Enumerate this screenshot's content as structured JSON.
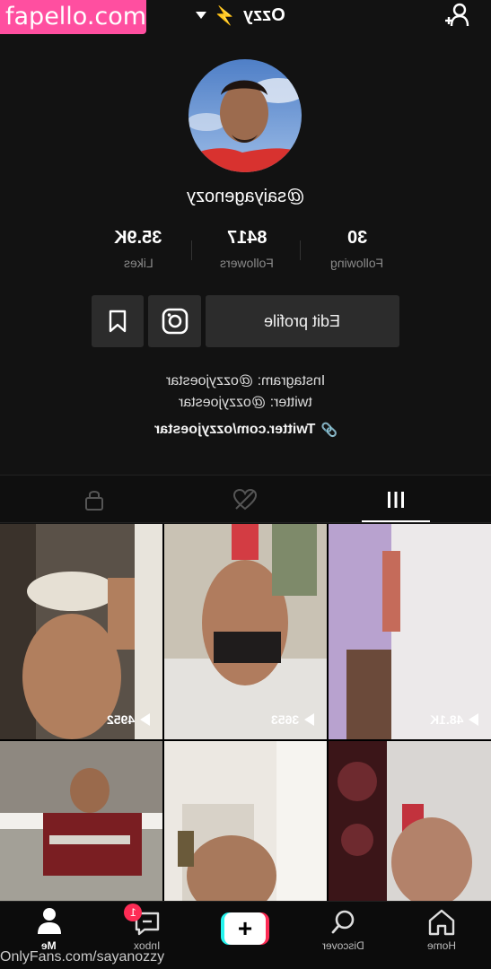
{
  "watermark": {
    "site": "fapello.com",
    "footer": "OnlyFans.com/sayanozzy"
  },
  "header": {
    "account_name": "Ozzy",
    "account_emoji": "⚡"
  },
  "profile": {
    "username": "@saiyagenozy",
    "stats": [
      {
        "value": "30",
        "label": "Following"
      },
      {
        "value": "8417",
        "label": "Followers"
      },
      {
        "value": "35.9K",
        "label": "Likes"
      }
    ],
    "edit_profile_label": "Edit profile",
    "bio_lines": [
      "Instagram: @ozzyjoestar",
      "twitter: @ozzyjoestar"
    ],
    "link": "Twitter.com/ozzyjoestar"
  },
  "videos": [
    {
      "views": "48.1K"
    },
    {
      "views": "3653"
    },
    {
      "views": "4952"
    },
    {
      "views": ""
    },
    {
      "views": ""
    },
    {
      "views": ""
    }
  ],
  "nav": {
    "home": "Home",
    "discover": "Discover",
    "inbox": "Inbox",
    "inbox_badge": "1",
    "me": "Me",
    "create": "+"
  },
  "colors": {
    "accent_red": "#fe2c55",
    "accent_cyan": "#25f4ee",
    "watermark_pink": "#ff4fa0"
  }
}
